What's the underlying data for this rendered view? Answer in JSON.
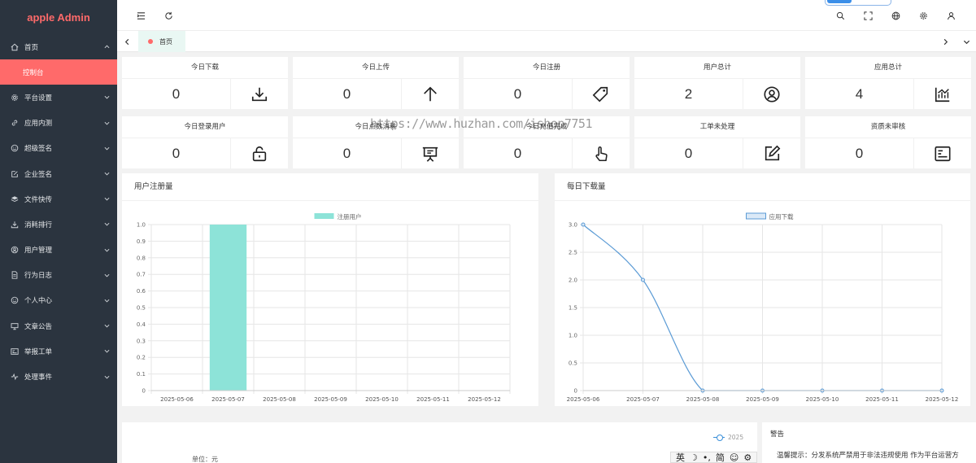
{
  "app": {
    "brand": "apple Admin"
  },
  "sidebar": {
    "items": [
      {
        "label": "首页",
        "icon": "home-icon"
      },
      {
        "label": "控制台",
        "icon": ""
      },
      {
        "label": "平台设置",
        "icon": "gear-icon"
      },
      {
        "label": "应用内测",
        "icon": "link-icon"
      },
      {
        "label": "超级签名",
        "icon": "smile-icon"
      },
      {
        "label": "企业签名",
        "icon": "edit-icon"
      },
      {
        "label": "文件快传",
        "icon": "layers-icon"
      },
      {
        "label": "消耗排行",
        "icon": "download-icon"
      },
      {
        "label": "用户管理",
        "icon": "user-circle-icon"
      },
      {
        "label": "行为日志",
        "icon": "file-icon"
      },
      {
        "label": "个人中心",
        "icon": "smile-icon"
      },
      {
        "label": "文章公告",
        "icon": "monitor-icon"
      },
      {
        "label": "举报工单",
        "icon": "id-card-icon"
      },
      {
        "label": "处理事件",
        "icon": "pulse-icon"
      }
    ]
  },
  "tabs": {
    "home_label": "首页"
  },
  "stats": [
    {
      "title": "今日下载",
      "value": "0",
      "icon": "download-icon"
    },
    {
      "title": "今日上传",
      "value": "0",
      "icon": "arrow-up-icon"
    },
    {
      "title": "今日注册",
      "value": "0",
      "icon": "tag-icon"
    },
    {
      "title": "用户总计",
      "value": "2",
      "icon": "user-circle-icon"
    },
    {
      "title": "应用总计",
      "value": "4",
      "icon": "chart-icon"
    },
    {
      "title": "今日登录用户",
      "value": "0",
      "icon": "lock-icon"
    },
    {
      "title": "今日点数消耗",
      "value": "0",
      "icon": "presentation-icon"
    },
    {
      "title": "今日充值完成",
      "value": "0",
      "icon": "pointer-hand-icon"
    },
    {
      "title": "工单未处理",
      "value": "0",
      "icon": "edit-icon"
    },
    {
      "title": "资质未审核",
      "value": "0",
      "icon": "id-card-icon"
    }
  ],
  "panels": {
    "registrations_title": "用户注册量",
    "downloads_title": "每日下载量",
    "warning_title": "警告",
    "warning_text": "温馨提示：分发系统严禁用于非法违规使用 作为平台运营方",
    "unit_label": "单位：元",
    "legend_2025": "2025"
  },
  "chart_data": [
    {
      "type": "bar",
      "title": "用户注册量",
      "categories": [
        "2025-05-06",
        "2025-05-07",
        "2025-05-08",
        "2025-05-09",
        "2025-05-10",
        "2025-05-11",
        "2025-05-12"
      ],
      "series": [
        {
          "name": "注册用户",
          "values": [
            0,
            1,
            0,
            0,
            0,
            0,
            0
          ],
          "color": "#8de3d8"
        }
      ],
      "ylim": [
        0,
        1.0
      ],
      "yticks": [
        "0",
        "0.1",
        "0.2",
        "0.3",
        "0.4",
        "0.5",
        "0.6",
        "0.7",
        "0.8",
        "0.9",
        "1.0"
      ],
      "grid": true,
      "legend": "top-center"
    },
    {
      "type": "line",
      "title": "每日下载量",
      "categories": [
        "2025-05-06",
        "2025-05-07",
        "2025-05-08",
        "2025-05-09",
        "2025-05-10",
        "2025-05-11",
        "2025-05-12"
      ],
      "series": [
        {
          "name": "应用下载",
          "values": [
            3,
            2,
            0,
            0,
            0,
            0,
            0
          ],
          "color": "#5b9bd5"
        }
      ],
      "ylim": [
        0,
        3.0
      ],
      "yticks": [
        "0",
        "0.5",
        "1.0",
        "1.5",
        "2.0",
        "2.5",
        "3.0"
      ],
      "grid": true,
      "legend": "top-center"
    }
  ],
  "overlay": {
    "watermark": "https://www.huzhan.com/ishop7751",
    "ime_text": [
      "英",
      "简"
    ]
  }
}
